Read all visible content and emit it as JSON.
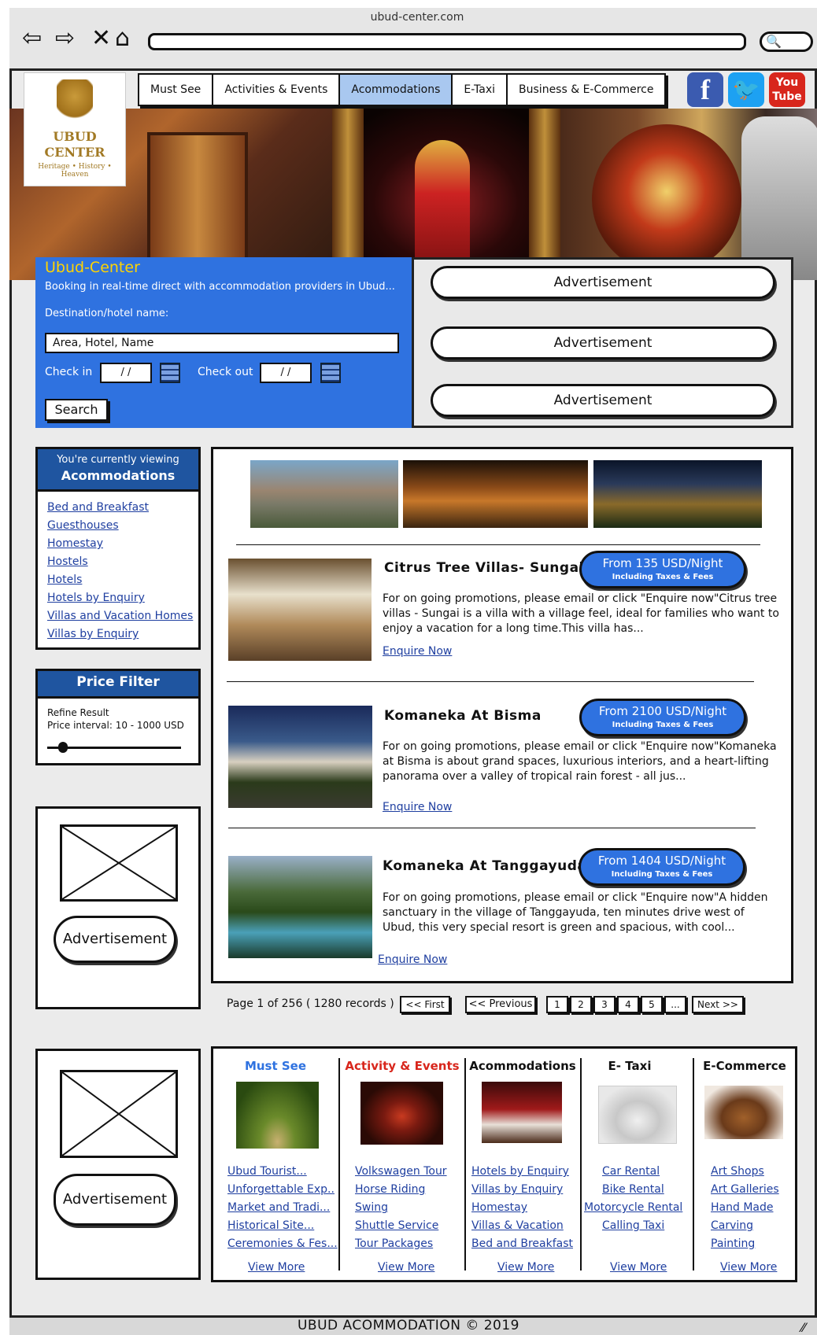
{
  "browser": {
    "url": "ubud-center.com"
  },
  "logo": {
    "name_line1": "UBUD",
    "name_line2": "CENTER",
    "tagline": "Heritage • History • Heaven"
  },
  "nav": {
    "tabs": [
      "Must See",
      "Activities & Events",
      "Acommodations",
      "E-Taxi",
      "Business & E-Commerce"
    ],
    "active": "Acommodations"
  },
  "social": {
    "facebook": "f",
    "youtube_line1": "You",
    "youtube_line2": "Tube"
  },
  "booking": {
    "title": "Ubud-Center",
    "subtitle": "Booking in real-time direct with accommodation providers in Ubud...",
    "dest_label": "Destination/hotel name:",
    "dest_placeholder": "Area, Hotel, Name",
    "checkin_label": "Check in",
    "checkin_value": "/ /",
    "checkout_label": "Check out",
    "checkout_value": "/ /",
    "search_label": "Search"
  },
  "ads": {
    "label": "Advertisement"
  },
  "sidebar": {
    "viewing_line1": "You're currently viewing",
    "viewing_line2": "Acommodations",
    "categories": [
      "Bed and Breakfast",
      "Guesthouses",
      "Homestay",
      "Hostels",
      "Hotels",
      "Hotels by Enquiry",
      "Villas and Vacation Homes",
      "Villas by Enquiry"
    ],
    "price_filter_title": "Price Filter",
    "refine_label": "Refine Result",
    "price_interval": "Price interval: 10 - 1000 USD",
    "slider_level": 0.08
  },
  "listings": [
    {
      "title": "Citrus Tree Villas- Sungai",
      "price": "From 135 USD/Night",
      "price_note": "Including Taxes & Fees",
      "desc": "For on going promotions, please email or click \"Enquire now\"Citrus tree villas - Sungai is a villa with a village feel, ideal for families who want to enjoy a vacation for a long time.This villa has...",
      "link": "Enquire Now"
    },
    {
      "title": "Komaneka At Bisma",
      "price": "From 2100 USD/Night",
      "price_note": "Including Taxes & Fees",
      "desc": "For on going promotions, please email or click \"Enquire now\"Komaneka at Bisma is about grand spaces, luxurious interiors, and a heart-lifting panorama over a valley of tropical rain forest - all jus...",
      "link": "Enquire Now"
    },
    {
      "title": "Komaneka At Tanggayuda",
      "price": "From 1404 USD/Night",
      "price_note": "Including Taxes & Fees",
      "desc": "For on going promotions, please email or click \"Enquire now\"A hidden sanctuary in the village of Tanggayuda, ten minutes drive west of Ubud, this very special resort is green and spacious, with cool...",
      "link": "Enquire Now"
    }
  ],
  "pagination": {
    "info": "Page 1 of 256 ( 1280 records )",
    "first": "<< First",
    "previous": "<< Previous",
    "pages": [
      "1",
      "2",
      "3",
      "4",
      "5",
      "..."
    ],
    "next": "Next >>"
  },
  "footer_nav": [
    {
      "title": "Must See",
      "color": "#2f72e0",
      "links": [
        "Ubud Tourist...",
        "Unforgettable Exp..",
        "Market and Tradi...",
        "Historical Site...",
        "Ceremonies & Fes..."
      ],
      "more": "View More"
    },
    {
      "title": "Activity & Events",
      "color": "#d8261c",
      "links": [
        "Volkswagen Tour",
        "Horse Riding",
        "Swing",
        "Shuttle Service",
        "Tour Packages"
      ],
      "more": "View More"
    },
    {
      "title": "Acommodations",
      "color": "#111111",
      "links": [
        "Hotels by Enquiry",
        "Villas by Enquiry",
        "Homestay",
        "Villas & Vacation",
        "Bed and Breakfast"
      ],
      "more": "View More"
    },
    {
      "title": "E- Taxi",
      "color": "#111111",
      "links": [
        "Car Rental",
        "Bike Rental",
        "Motorcycle Rental",
        "Calling Taxi"
      ],
      "more": "View More"
    },
    {
      "title": "E-Commerce",
      "color": "#111111",
      "links": [
        "Art Shops",
        "Art Galleries",
        "Hand Made",
        "Carving",
        "Painting"
      ],
      "more": "View More"
    }
  ],
  "footer": {
    "copyright": "UBUD ACOMMODATION © 2019"
  }
}
